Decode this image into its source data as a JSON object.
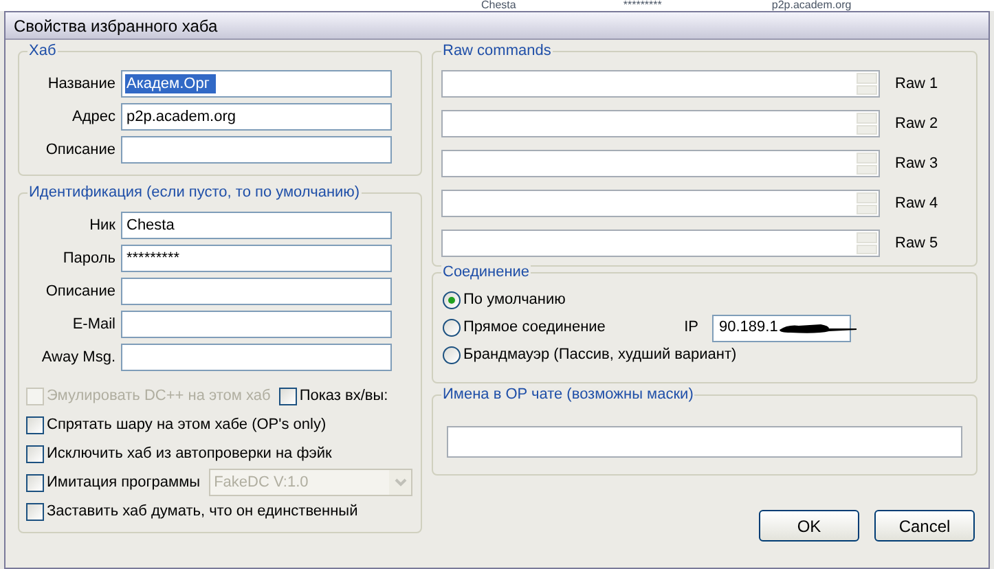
{
  "background_row": [
    "Chesta",
    "*********",
    "p2p.academ.org"
  ],
  "window": {
    "title": "Свойства избранного хаба"
  },
  "hub": {
    "title": "Хаб",
    "fields": [
      {
        "label": "Название",
        "value": "Академ.Орг",
        "selected": true
      },
      {
        "label": "Адрес",
        "value": "p2p.academ.org",
        "selected": false
      },
      {
        "label": "Описание",
        "selected": false
      }
    ]
  },
  "identity": {
    "title": "Идентификация (если пусто, то по умолчанию)",
    "fields": [
      {
        "label": "Ник",
        "value": "Chesta"
      },
      {
        "label": "Пароль",
        "value": "*********"
      },
      {
        "label": "Описание"
      },
      {
        "label": "E-Mail"
      },
      {
        "label": "Away Msg."
      }
    ]
  },
  "options": [
    {
      "kind": "pair",
      "items": [
        {
          "label": "Эмулировать DC++ на этом хаб",
          "checked": false,
          "disabled": true
        },
        {
          "label": "Показ вх/вы:",
          "checked": false,
          "disabled": false
        }
      ]
    },
    {
      "kind": "check",
      "label": "Спрятать шару на этом хабе (OP's only)",
      "checked": false,
      "disabled": false
    },
    {
      "kind": "check",
      "label": "Исключить хаб из автопроверки на фэйк",
      "checked": false,
      "disabled": false
    },
    {
      "kind": "combo",
      "label": "Имитация программы",
      "checked": false,
      "disabled": false,
      "combo": {
        "value": "FakeDC V:1.0",
        "disabled": true
      }
    },
    {
      "kind": "check",
      "label": "Заставить хаб думать, что он единственный",
      "checked": false,
      "disabled": false
    }
  ],
  "raw_commands": {
    "title": "Raw commands",
    "rows": [
      {
        "label": "Raw 1"
      },
      {
        "label": "Raw 2"
      },
      {
        "label": "Raw 3"
      },
      {
        "label": "Raw 4"
      },
      {
        "label": "Raw 5"
      }
    ]
  },
  "connection": {
    "title": "Соединение",
    "options": [
      {
        "label": "По умолчанию",
        "selected": true
      },
      {
        "label": "Прямое соединение",
        "selected": false
      },
      {
        "label": "Брандмауэр (Пассив, худший вариант)",
        "selected": false
      }
    ],
    "ip_label": "IP",
    "ip_value": "90.189.1"
  },
  "op_chat": {
    "title": "Имена в OP чате (возможны маски)"
  },
  "buttons": [
    {
      "label": "OK"
    },
    {
      "label": "Cancel"
    }
  ]
}
